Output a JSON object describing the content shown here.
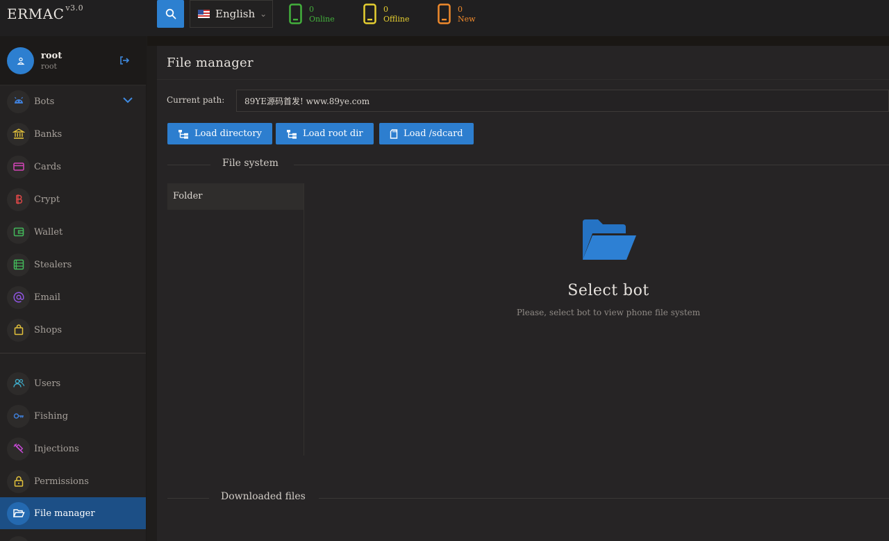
{
  "app": {
    "name": "ERMAC",
    "version": "v3.0"
  },
  "topbar": {
    "language": "English",
    "stats": [
      {
        "count": "0",
        "label": "Online",
        "color": "#43b13c"
      },
      {
        "count": "0",
        "label": "Offline",
        "color": "#e6cf31"
      },
      {
        "count": "0",
        "label": "New",
        "color": "#f08a2c"
      }
    ]
  },
  "user": {
    "name": "root",
    "role": "root"
  },
  "sidebar": {
    "items": [
      {
        "label": "Bots",
        "icon": "android-icon",
        "color": "#3f7fd8"
      },
      {
        "label": "Banks",
        "icon": "bank-icon",
        "color": "#e3c23b"
      },
      {
        "label": "Cards",
        "icon": "credit-card-icon",
        "color": "#d445b8"
      },
      {
        "label": "Crypt",
        "icon": "bitcoin-icon",
        "color": "#e04848"
      },
      {
        "label": "Wallet",
        "icon": "wallet-icon",
        "color": "#43b95a"
      },
      {
        "label": "Stealers",
        "icon": "list-icon",
        "color": "#43b95a"
      },
      {
        "label": "Email",
        "icon": "at-sign-icon",
        "color": "#8f55e0"
      },
      {
        "label": "Shops",
        "icon": "shopping-bag-icon",
        "color": "#e3c23b"
      },
      {
        "label": "Users",
        "icon": "users-icon",
        "color": "#3fa9c6"
      },
      {
        "label": "Fishing",
        "icon": "key-icon",
        "color": "#3f7fd8"
      },
      {
        "label": "Injections",
        "icon": "syringe-icon",
        "color": "#c94ad8"
      },
      {
        "label": "Permissions",
        "icon": "lock-icon",
        "color": "#e3c23b"
      },
      {
        "label": "File manager",
        "icon": "folder-open-icon",
        "color": "#ffffff"
      }
    ]
  },
  "main": {
    "title": "File manager",
    "path_label": "Current path:",
    "path_value": "89YE源码首发! www.89ye.com",
    "buttons": {
      "load_directory": "Load directory",
      "load_root": "Load root dir",
      "load_sdcard": "Load /sdcard"
    },
    "file_system_title": "File system",
    "folder_header": "Folder",
    "empty_title": "Select bot",
    "empty_text": "Please, select bot to view phone file system",
    "downloads_title": "Downloaded files"
  }
}
